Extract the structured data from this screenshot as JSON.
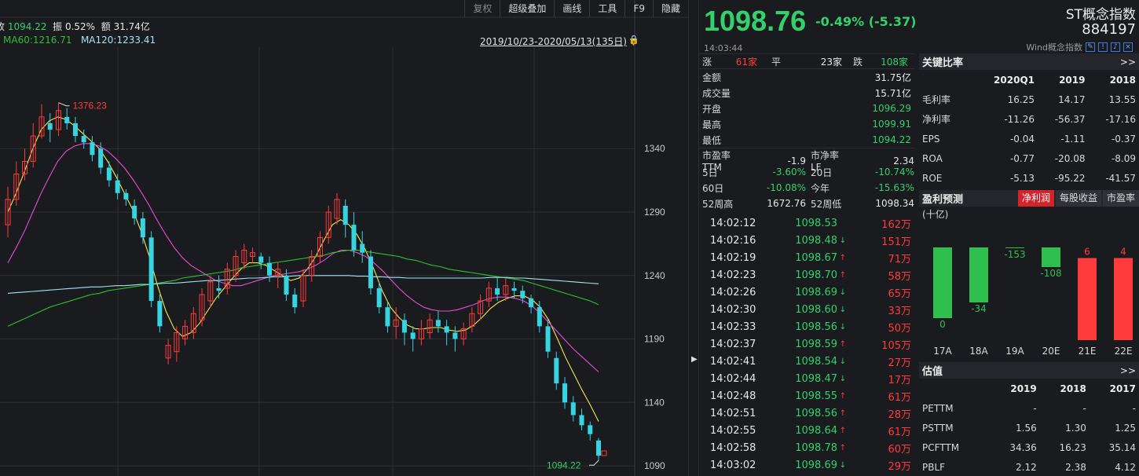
{
  "toolbar": {
    "items": [
      "复权",
      "超级叠加",
      "画线",
      "工具",
      "F9",
      "隐藏"
    ]
  },
  "chart_info": {
    "close_label": "收",
    "close_value": "1094.22",
    "amp_label": "振",
    "amp_value": "0.52%",
    "amount_label": "额",
    "amount_value": "31.74亿",
    "ma60": "MA60:1216.71",
    "ma120": "MA120:1233.41",
    "range": "2019/10/23-2020/05/13(135日)",
    "high_marker": "1376.23",
    "low_marker": "1094.22"
  },
  "chart_data": {
    "type": "candlestick",
    "y_ticks": [
      "1340",
      "1290",
      "1240",
      "1190",
      "1140",
      "1090"
    ],
    "y_tick_values": [
      1340,
      1290,
      1240,
      1190,
      1140,
      1090
    ],
    "ylim": [
      1082,
      1420
    ],
    "candles": [
      {
        "o": 1280,
        "c": 1300,
        "h": 1310,
        "l": 1270
      },
      {
        "o": 1300,
        "c": 1320,
        "h": 1330,
        "l": 1295
      },
      {
        "o": 1320,
        "c": 1330,
        "h": 1340,
        "l": 1315
      },
      {
        "o": 1330,
        "c": 1350,
        "h": 1360,
        "l": 1325
      },
      {
        "o": 1350,
        "c": 1365,
        "h": 1375,
        "l": 1348
      },
      {
        "o": 1360,
        "c": 1355,
        "h": 1368,
        "l": 1345
      },
      {
        "o": 1355,
        "c": 1370,
        "h": 1376.23,
        "l": 1350
      },
      {
        "o": 1365,
        "c": 1360,
        "h": 1372,
        "l": 1355
      },
      {
        "o": 1360,
        "c": 1350,
        "h": 1365,
        "l": 1345
      },
      {
        "o": 1350,
        "c": 1345,
        "h": 1355,
        "l": 1340
      },
      {
        "o": 1345,
        "c": 1335,
        "h": 1350,
        "l": 1330
      },
      {
        "o": 1340,
        "c": 1325,
        "h": 1345,
        "l": 1320
      },
      {
        "o": 1325,
        "c": 1315,
        "h": 1330,
        "l": 1310
      },
      {
        "o": 1315,
        "c": 1305,
        "h": 1320,
        "l": 1300
      },
      {
        "o": 1305,
        "c": 1300,
        "h": 1308,
        "l": 1295
      },
      {
        "o": 1295,
        "c": 1285,
        "h": 1300,
        "l": 1280
      },
      {
        "o": 1285,
        "c": 1270,
        "h": 1290,
        "l": 1265
      },
      {
        "o": 1270,
        "c": 1220,
        "h": 1275,
        "l": 1215
      },
      {
        "o": 1220,
        "c": 1200,
        "h": 1225,
        "l": 1195
      },
      {
        "o": 1175,
        "c": 1185,
        "h": 1190,
        "l": 1170
      },
      {
        "o": 1180,
        "c": 1195,
        "h": 1200,
        "l": 1172
      },
      {
        "o": 1190,
        "c": 1200,
        "h": 1205,
        "l": 1185
      },
      {
        "o": 1195,
        "c": 1210,
        "h": 1215,
        "l": 1190
      },
      {
        "o": 1205,
        "c": 1225,
        "h": 1230,
        "l": 1200
      },
      {
        "o": 1220,
        "c": 1235,
        "h": 1240,
        "l": 1215
      },
      {
        "o": 1230,
        "c": 1228,
        "h": 1240,
        "l": 1222
      },
      {
        "o": 1230,
        "c": 1245,
        "h": 1250,
        "l": 1225
      },
      {
        "o": 1240,
        "c": 1255,
        "h": 1260,
        "l": 1235
      },
      {
        "o": 1250,
        "c": 1260,
        "h": 1265,
        "l": 1245
      },
      {
        "o": 1255,
        "c": 1258,
        "h": 1262,
        "l": 1250
      },
      {
        "o": 1255,
        "c": 1250,
        "h": 1258,
        "l": 1245
      },
      {
        "o": 1250,
        "c": 1240,
        "h": 1255,
        "l": 1235
      },
      {
        "o": 1240,
        "c": 1245,
        "h": 1250,
        "l": 1230
      },
      {
        "o": 1240,
        "c": 1225,
        "h": 1245,
        "l": 1220
      },
      {
        "o": 1225,
        "c": 1215,
        "h": 1230,
        "l": 1210
      },
      {
        "o": 1220,
        "c": 1240,
        "h": 1245,
        "l": 1215
      },
      {
        "o": 1240,
        "c": 1255,
        "h": 1260,
        "l": 1235
      },
      {
        "o": 1255,
        "c": 1270,
        "h": 1275,
        "l": 1250
      },
      {
        "o": 1270,
        "c": 1290,
        "h": 1295,
        "l": 1265
      },
      {
        "o": 1285,
        "c": 1300,
        "h": 1305,
        "l": 1280
      },
      {
        "o": 1295,
        "c": 1280,
        "h": 1300,
        "l": 1270
      },
      {
        "o": 1280,
        "c": 1260,
        "h": 1290,
        "l": 1255
      },
      {
        "o": 1265,
        "c": 1258,
        "h": 1275,
        "l": 1250
      },
      {
        "o": 1255,
        "c": 1230,
        "h": 1260,
        "l": 1225
      },
      {
        "o": 1230,
        "c": 1215,
        "h": 1235,
        "l": 1210
      },
      {
        "o": 1215,
        "c": 1200,
        "h": 1220,
        "l": 1195
      },
      {
        "o": 1200,
        "c": 1205,
        "h": 1215,
        "l": 1190
      },
      {
        "o": 1205,
        "c": 1195,
        "h": 1210,
        "l": 1185
      },
      {
        "o": 1195,
        "c": 1190,
        "h": 1200,
        "l": 1180
      },
      {
        "o": 1190,
        "c": 1198,
        "h": 1205,
        "l": 1185
      },
      {
        "o": 1195,
        "c": 1205,
        "h": 1210,
        "l": 1190
      },
      {
        "o": 1205,
        "c": 1200,
        "h": 1212,
        "l": 1195
      },
      {
        "o": 1200,
        "c": 1195,
        "h": 1205,
        "l": 1185
      },
      {
        "o": 1195,
        "c": 1190,
        "h": 1200,
        "l": 1180
      },
      {
        "o": 1190,
        "c": 1198,
        "h": 1203,
        "l": 1185
      },
      {
        "o": 1200,
        "c": 1210,
        "h": 1215,
        "l": 1195
      },
      {
        "o": 1210,
        "c": 1220,
        "h": 1225,
        "l": 1205
      },
      {
        "o": 1220,
        "c": 1230,
        "h": 1235,
        "l": 1215
      },
      {
        "o": 1230,
        "c": 1225,
        "h": 1238,
        "l": 1220
      },
      {
        "o": 1225,
        "c": 1232,
        "h": 1238,
        "l": 1220
      },
      {
        "o": 1230,
        "c": 1228,
        "h": 1235,
        "l": 1222
      },
      {
        "o": 1228,
        "c": 1222,
        "h": 1232,
        "l": 1218
      },
      {
        "o": 1222,
        "c": 1215,
        "h": 1225,
        "l": 1210
      },
      {
        "o": 1215,
        "c": 1200,
        "h": 1220,
        "l": 1195
      },
      {
        "o": 1200,
        "c": 1180,
        "h": 1205,
        "l": 1175
      },
      {
        "o": 1175,
        "c": 1155,
        "h": 1180,
        "l": 1150
      },
      {
        "o": 1155,
        "c": 1140,
        "h": 1160,
        "l": 1135
      },
      {
        "o": 1140,
        "c": 1130,
        "h": 1145,
        "l": 1125
      },
      {
        "o": 1130,
        "c": 1122,
        "h": 1135,
        "l": 1118
      },
      {
        "o": 1122,
        "c": 1115,
        "h": 1125,
        "l": 1110
      },
      {
        "o": 1110,
        "c": 1098,
        "h": 1112,
        "l": 1094.22
      }
    ],
    "ma_series": [
      {
        "color": "#f2e94e",
        "values": [
          1290,
          1305,
          1322,
          1340,
          1355,
          1362,
          1365,
          1363,
          1358,
          1352,
          1346,
          1340,
          1330,
          1318,
          1305,
          1292,
          1275,
          1255,
          1232,
          1212,
          1198,
          1192,
          1195,
          1202,
          1212,
          1222,
          1230,
          1238,
          1245,
          1250,
          1250,
          1248,
          1244,
          1240,
          1236,
          1238,
          1245,
          1255,
          1268,
          1280,
          1284,
          1280,
          1272,
          1260,
          1245,
          1228,
          1215,
          1207,
          1201,
          1198,
          1198,
          1199,
          1199,
          1197,
          1196,
          1197,
          1201,
          1207,
          1214,
          1219,
          1222,
          1224,
          1224,
          1221,
          1215,
          1205,
          1191,
          1176,
          1163,
          1150,
          1138,
          1125
        ]
      },
      {
        "color": "#e84bd6",
        "values": [
          1250,
          1262,
          1275,
          1290,
          1305,
          1318,
          1330,
          1338,
          1342,
          1344,
          1344,
          1342,
          1338,
          1332,
          1325,
          1316,
          1306,
          1295,
          1283,
          1272,
          1262,
          1254,
          1248,
          1244,
          1240,
          1236,
          1234,
          1232,
          1232,
          1234,
          1236,
          1238,
          1240,
          1241,
          1242,
          1243,
          1245,
          1248,
          1252,
          1257,
          1260,
          1260,
          1258,
          1255,
          1250,
          1244,
          1237,
          1230,
          1224,
          1219,
          1215,
          1213,
          1212,
          1212,
          1213,
          1215,
          1217,
          1220,
          1222,
          1223,
          1223,
          1222,
          1220,
          1216,
          1210,
          1203,
          1196,
          1189,
          1182,
          1176,
          1170,
          1164
        ]
      },
      {
        "color": "#2fbf2f",
        "values": [
          1200,
          1203,
          1206,
          1209,
          1212,
          1215,
          1217,
          1219,
          1221,
          1223,
          1225,
          1226,
          1228,
          1229,
          1230,
          1231,
          1232,
          1233,
          1234,
          1235,
          1236,
          1238,
          1239,
          1240,
          1241,
          1242,
          1243,
          1244,
          1246,
          1247,
          1248,
          1249,
          1250,
          1251,
          1252,
          1253,
          1254,
          1255,
          1256,
          1258,
          1259,
          1260,
          1260,
          1259,
          1258,
          1257,
          1256,
          1255,
          1253,
          1252,
          1250,
          1248,
          1247,
          1245,
          1244,
          1243,
          1242,
          1241,
          1240,
          1239,
          1238,
          1237,
          1236,
          1234,
          1232,
          1230,
          1228,
          1226,
          1224,
          1222,
          1220,
          1217
        ]
      },
      {
        "color": "#9fe6f0",
        "values": [
          1226,
          1226.5,
          1227,
          1227.5,
          1228,
          1228.5,
          1229,
          1229.5,
          1230,
          1230.5,
          1231,
          1231,
          1231.5,
          1232,
          1232,
          1232.5,
          1233,
          1233,
          1233.5,
          1234,
          1234,
          1234.5,
          1235,
          1235.5,
          1236,
          1236,
          1236.5,
          1237,
          1237.5,
          1238,
          1238,
          1238.5,
          1239,
          1239,
          1239.5,
          1240,
          1240,
          1240,
          1240,
          1240,
          1240,
          1240,
          1239.5,
          1239.5,
          1239,
          1239,
          1238.5,
          1238.5,
          1238,
          1238,
          1238,
          1238,
          1238,
          1238,
          1238,
          1238,
          1238,
          1238,
          1238.5,
          1238.5,
          1238.5,
          1238,
          1238,
          1237.5,
          1237,
          1236.5,
          1236,
          1235.5,
          1235,
          1234.5,
          1234,
          1233.5
        ]
      }
    ]
  },
  "quote": {
    "price": "1098.76",
    "change": "-0.49% (-5.37)",
    "name": "ST概念指数",
    "code": "884197",
    "time": "14:03:44",
    "source": "Wind概念指数"
  },
  "breadth": {
    "up_label": "涨",
    "up": "61家",
    "flat_label": "平",
    "flat": "23家",
    "down_label": "跌",
    "down": "108家"
  },
  "stats": [
    {
      "k": "金额",
      "v": "31.75亿",
      "c": "w"
    },
    {
      "k": "成交量",
      "v": "15.71亿",
      "c": "w"
    },
    {
      "k": "开盘",
      "v": "1096.29",
      "c": "g"
    },
    {
      "k": "最高",
      "v": "1099.91",
      "c": "g"
    },
    {
      "k": "最低",
      "v": "1094.22",
      "c": "g"
    }
  ],
  "stats4": [
    {
      "k1": "市盈率TTM",
      "v1": "-1.9",
      "c1": "w",
      "k2": "市净率LF",
      "v2": "2.34",
      "c2": "w"
    },
    {
      "k1": "5日",
      "v1": "-3.60%",
      "c1": "g",
      "k2": "20日",
      "v2": "-10.74%",
      "c2": "g"
    },
    {
      "k1": "60日",
      "v1": "-10.08%",
      "c1": "g",
      "k2": "今年",
      "v2": "-15.63%",
      "c2": "g"
    },
    {
      "k1": "52周高",
      "v1": "1672.76",
      "c1": "w",
      "k2": "52周低",
      "v2": "1098.34",
      "c2": "w"
    }
  ],
  "ticks": [
    {
      "t": "14:02:12",
      "p": "1098.53",
      "d": "",
      "v": "162万"
    },
    {
      "t": "14:02:16",
      "p": "1098.48",
      "d": "down",
      "v": "151万"
    },
    {
      "t": "14:02:19",
      "p": "1098.67",
      "d": "up",
      "v": "71万"
    },
    {
      "t": "14:02:23",
      "p": "1098.70",
      "d": "up",
      "v": "58万"
    },
    {
      "t": "14:02:26",
      "p": "1098.69",
      "d": "down",
      "v": "65万"
    },
    {
      "t": "14:02:30",
      "p": "1098.60",
      "d": "down",
      "v": "33万"
    },
    {
      "t": "14:02:33",
      "p": "1098.56",
      "d": "down",
      "v": "50万"
    },
    {
      "t": "14:02:37",
      "p": "1098.59",
      "d": "up",
      "v": "105万"
    },
    {
      "t": "14:02:41",
      "p": "1098.54",
      "d": "down",
      "v": "27万"
    },
    {
      "t": "14:02:44",
      "p": "1098.47",
      "d": "down",
      "v": "17万"
    },
    {
      "t": "14:02:48",
      "p": "1098.55",
      "d": "up",
      "v": "61万"
    },
    {
      "t": "14:02:51",
      "p": "1098.56",
      "d": "up",
      "v": "28万"
    },
    {
      "t": "14:02:55",
      "p": "1098.64",
      "d": "up",
      "v": "61万"
    },
    {
      "t": "14:02:58",
      "p": "1098.78",
      "d": "up",
      "v": "60万"
    },
    {
      "t": "14:03:02",
      "p": "1098.69",
      "d": "down",
      "v": "29万"
    }
  ],
  "ratios": {
    "title": "关键比率",
    "more": ">>",
    "cols": [
      "2020Q1",
      "2019",
      "2018"
    ],
    "rows": [
      {
        "k": "毛利率",
        "v": [
          "16.25",
          "14.17",
          "13.55"
        ]
      },
      {
        "k": "净利率",
        "v": [
          "-11.26",
          "-56.37",
          "-17.16"
        ]
      },
      {
        "k": "EPS",
        "v": [
          "-0.04",
          "-1.11",
          "-0.37"
        ]
      },
      {
        "k": "ROA",
        "v": [
          "-0.77",
          "-20.08",
          "-8.09"
        ]
      },
      {
        "k": "ROE",
        "v": [
          "-5.13",
          "-95.22",
          "-41.57"
        ]
      }
    ]
  },
  "forecast": {
    "title": "盈利预测",
    "tabs": [
      "净利润",
      "每股收益",
      "市盈率"
    ],
    "unit": "(十亿)",
    "chart_data": {
      "type": "bar",
      "categories": [
        "17A",
        "18A",
        "19A",
        "20E",
        "21E",
        "22E"
      ],
      "values": [
        0,
        -34,
        -153,
        -108,
        6,
        4
      ],
      "bar_values": [
        -0.9,
        -0.7,
        -0.01,
        -0.25,
        0.95,
        0.95
      ],
      "labels": [
        "0",
        "-34",
        "-153",
        "-108",
        "6",
        "4"
      ]
    }
  },
  "valuation": {
    "title": "估值",
    "more": ">>",
    "cols": [
      "2019",
      "2018",
      "2017"
    ],
    "rows": [
      {
        "k": "PETTM",
        "v": [
          "-",
          "-",
          "-"
        ]
      },
      {
        "k": "PSTTM",
        "v": [
          "1.56",
          "1.30",
          "1.25"
        ]
      },
      {
        "k": "PCFTTM",
        "v": [
          "34.36",
          "16.23",
          "35.14"
        ]
      },
      {
        "k": "PBLF",
        "v": [
          "2.12",
          "2.38",
          "4.12"
        ]
      }
    ]
  },
  "colors": {
    "up": "#ff3b3b",
    "down": "#33d06b",
    "cyan": "#36d3e0",
    "bg": "#1a1b1f"
  }
}
